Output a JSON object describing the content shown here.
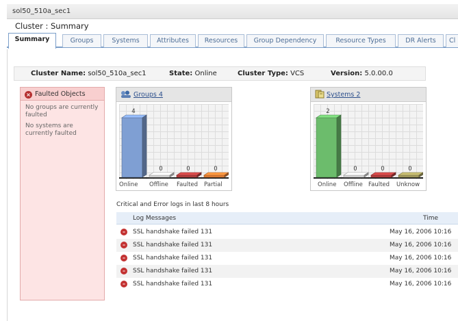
{
  "window": {
    "title": "sol50_510a_sec1"
  },
  "page": {
    "title": "Cluster : Summary"
  },
  "tabs": [
    {
      "label": "Summary",
      "active": true
    },
    {
      "label": "Groups"
    },
    {
      "label": "Systems"
    },
    {
      "label": "Attributes"
    },
    {
      "label": "Resources"
    },
    {
      "label": "Group Dependency"
    },
    {
      "label": "Resource Types"
    },
    {
      "label": "DR Alerts"
    },
    {
      "label": "Cl"
    }
  ],
  "cluster_info": {
    "name_label": "Cluster Name:",
    "name_value": "sol50_510a_sec1",
    "state_label": "State:",
    "state_value": "Online",
    "type_label": "Cluster Type:",
    "type_value": "VCS",
    "version_label": "Version:",
    "version_value": "5.0.00.0"
  },
  "faulted": {
    "title": "Faulted Objects",
    "icon": "x-circle-icon",
    "messages": [
      "No groups are currently faulted",
      "No systems are currently faulted"
    ]
  },
  "groups_panel": {
    "title": "Groups 4",
    "icon": "groups-icon"
  },
  "systems_panel": {
    "title": "Systems 2",
    "icon": "systems-icon"
  },
  "chart_data": [
    {
      "type": "bar",
      "categories": [
        "Online",
        "Offline",
        "Faulted",
        "Partial"
      ],
      "values": [
        4,
        0,
        0,
        0
      ],
      "colors": [
        "#7f9fd3",
        "#d8d8d8",
        "#b84040",
        "#e58036"
      ],
      "ylim": [
        0,
        4
      ]
    },
    {
      "type": "bar",
      "categories": [
        "Online",
        "Offline",
        "Faulted",
        "Unknow"
      ],
      "values": [
        2,
        0,
        0,
        0
      ],
      "colors": [
        "#6cbc6c",
        "#d8d8d8",
        "#b84040",
        "#a8a060"
      ],
      "ylim": [
        0,
        2
      ]
    }
  ],
  "logs": {
    "caption": "Critical and Error logs in last 8 hours",
    "col_message": "Log Messages",
    "col_time": "Time",
    "rows": [
      {
        "message": "SSL handshake failed 131",
        "time": "May 16, 2006 10:16"
      },
      {
        "message": "SSL handshake failed 131",
        "time": "May 16, 2006 10:16"
      },
      {
        "message": "SSL handshake failed 131",
        "time": "May 16, 2006 10:16"
      },
      {
        "message": "SSL handshake failed 131",
        "time": "May 16, 2006 10:16"
      },
      {
        "message": "SSL handshake failed 131",
        "time": "May 16, 2006 10:16"
      }
    ]
  }
}
